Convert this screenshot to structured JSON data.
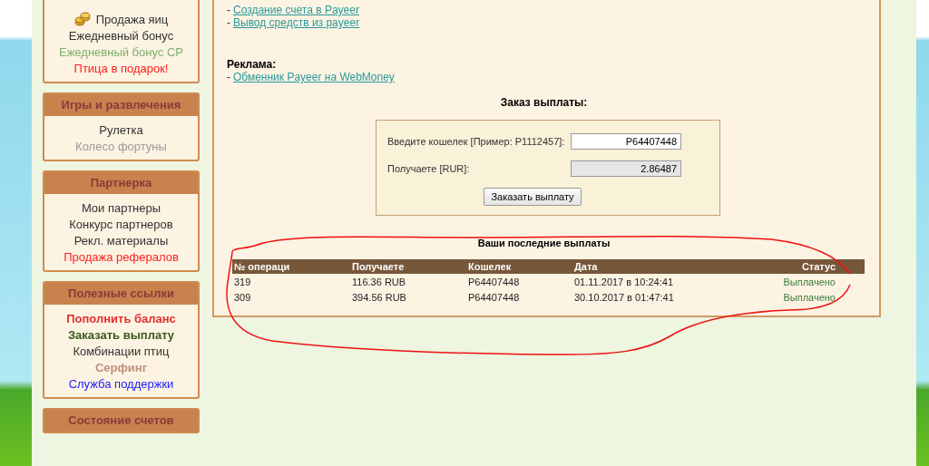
{
  "sidebar": [
    {
      "items": [
        {
          "label": "Продажа яиц",
          "kind": "with-icon",
          "color": "#333333",
          "bold": false
        },
        {
          "label": "Ежедневный бонус",
          "kind": "text",
          "color": "#333333",
          "bold": false
        },
        {
          "label": "Ежедневный бонус СР",
          "kind": "text",
          "color": "#7cb36a",
          "bold": false
        },
        {
          "label": "Птица в подарок!",
          "kind": "text",
          "color": "#ff1a1a",
          "bold": false
        }
      ]
    },
    {
      "title": "Игры и развлечения",
      "items": [
        {
          "label": "Рулетка",
          "kind": "text",
          "color": "#333333",
          "bold": false
        },
        {
          "label": "Колесо фортуны",
          "kind": "text",
          "color": "#999999",
          "bold": false
        }
      ]
    },
    {
      "title": "Партнерка",
      "items": [
        {
          "label": "Мои партнеры",
          "kind": "text",
          "color": "#333333",
          "bold": false
        },
        {
          "label": "Конкурс партнеров",
          "kind": "text",
          "color": "#333333",
          "bold": false
        },
        {
          "label": "Рекл. материалы",
          "kind": "text",
          "color": "#333333",
          "bold": false
        },
        {
          "label": "Продажа рефералов",
          "kind": "text",
          "color": "#ff2020",
          "bold": false
        }
      ]
    },
    {
      "title": "Полезные ссылки",
      "items": [
        {
          "label": "Пополнить баланс",
          "kind": "text",
          "color": "#e03030",
          "bold": true
        },
        {
          "label": "Заказать выплату",
          "kind": "text",
          "color": "#3a5a1a",
          "bold": true
        },
        {
          "label": "Комбинации птиц",
          "kind": "text",
          "color": "#333333",
          "bold": false
        },
        {
          "label": "Серфинг",
          "kind": "text",
          "color": "#c09080",
          "bold": true
        },
        {
          "label": "Служба поддержки",
          "kind": "text",
          "color": "#2020ff",
          "bold": false
        }
      ]
    },
    {
      "title": "Состояние счетов"
    }
  ],
  "links": [
    {
      "dash": "-",
      "text": "Создание счета в Payeer"
    },
    {
      "dash": "-",
      "text": "Вывод средств из payeer"
    }
  ],
  "ads": {
    "heading": "Реклама:",
    "links": [
      {
        "dash": "-",
        "text": "Обменник Payeer на WebMoney"
      }
    ]
  },
  "order_form": {
    "title": "Заказ выплаты:",
    "fields": [
      {
        "label": "Введите кошелек [Пример: P1112457]:",
        "value": "P64407448",
        "readonly": false
      },
      {
        "label": "Получаете [RUR]:",
        "value": "2.86487",
        "readonly": true
      }
    ],
    "button": "Заказать выплату"
  },
  "payouts": {
    "title": "Ваши последние выплаты",
    "columns": [
      "№ операци",
      "Получаете",
      "Кошелек",
      "Дата",
      "Статус"
    ],
    "rows": [
      {
        "cells": [
          "319",
          "116.36 RUB",
          "P64407448",
          "01.11.2017 в 10:24:41"
        ],
        "status": "Выплачено"
      },
      {
        "cells": [
          "309",
          "394.56 RUB",
          "P64407448",
          "30.10.2017 в 01:47:41"
        ],
        "status": "Выплачено"
      }
    ]
  }
}
